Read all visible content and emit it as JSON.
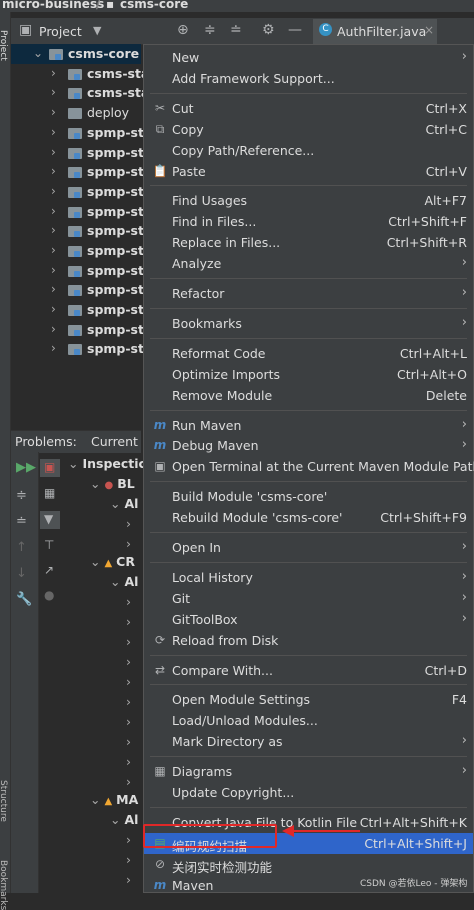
{
  "title_bar": {
    "project": "micro-business",
    "module": "csms-core"
  },
  "side_labels": {
    "project_tab": "Project",
    "structure_tab": "Structure",
    "bookmarks_tab": "Bookmarks"
  },
  "project_toolbar": {
    "view_label": "Project",
    "tab_label": "AuthFilter.java"
  },
  "tree": {
    "root": "csms-core",
    "items": [
      {
        "label": "csms-sta",
        "kind": "module"
      },
      {
        "label": "csms-sta",
        "kind": "module"
      },
      {
        "label": "deploy",
        "kind": "folder"
      },
      {
        "label": "spmp-sta",
        "kind": "module"
      },
      {
        "label": "spmp-sta",
        "kind": "module"
      },
      {
        "label": "spmp-sta",
        "kind": "module"
      },
      {
        "label": "spmp-sta",
        "kind": "module"
      },
      {
        "label": "spmp-sta",
        "kind": "module"
      },
      {
        "label": "spmp-sta",
        "kind": "module"
      },
      {
        "label": "spmp-sta",
        "kind": "module"
      },
      {
        "label": "spmp-sta",
        "kind": "module"
      },
      {
        "label": "spmp-sta",
        "kind": "module"
      },
      {
        "label": "spmp-sta",
        "kind": "module"
      },
      {
        "label": "spmp-sta",
        "kind": "module"
      },
      {
        "label": "spmp-sta",
        "kind": "module"
      }
    ]
  },
  "problems": {
    "tab_label": "Problems:",
    "current_label": "Current I",
    "root": "Inspectic",
    "groups": [
      {
        "label": "BL",
        "sub": "Al"
      },
      {
        "label": "CR",
        "sub": "Al"
      },
      {
        "label": "MA",
        "sub": "Al"
      }
    ]
  },
  "menu": [
    {
      "label": "New",
      "submenu": true
    },
    {
      "label": "Add Framework Support..."
    },
    {
      "sep": true
    },
    {
      "label": "Cut",
      "shortcut": "Ctrl+X",
      "icon": "✂"
    },
    {
      "label": "Copy",
      "shortcut": "Ctrl+C",
      "icon": "⧉"
    },
    {
      "label": "Copy Path/Reference..."
    },
    {
      "label": "Paste",
      "shortcut": "Ctrl+V",
      "icon": "📋"
    },
    {
      "sep": true
    },
    {
      "label": "Find Usages",
      "shortcut": "Alt+F7"
    },
    {
      "label": "Find in Files...",
      "shortcut": "Ctrl+Shift+F"
    },
    {
      "label": "Replace in Files...",
      "shortcut": "Ctrl+Shift+R"
    },
    {
      "label": "Analyze",
      "submenu": true
    },
    {
      "sep": true
    },
    {
      "label": "Refactor",
      "submenu": true
    },
    {
      "sep": true
    },
    {
      "label": "Bookmarks",
      "submenu": true
    },
    {
      "sep": true
    },
    {
      "label": "Reformat Code",
      "shortcut": "Ctrl+Alt+L"
    },
    {
      "label": "Optimize Imports",
      "shortcut": "Ctrl+Alt+O"
    },
    {
      "label": "Remove Module",
      "shortcut": "Delete"
    },
    {
      "sep": true
    },
    {
      "label": "Run Maven",
      "submenu": true,
      "icon": "m"
    },
    {
      "label": "Debug Maven",
      "submenu": true,
      "icon": "m"
    },
    {
      "label": "Open Terminal at the Current Maven Module Path",
      "icon": "▣"
    },
    {
      "sep": true
    },
    {
      "label": "Build Module 'csms-core'"
    },
    {
      "label": "Rebuild Module 'csms-core'",
      "shortcut": "Ctrl+Shift+F9"
    },
    {
      "sep": true
    },
    {
      "label": "Open In",
      "submenu": true
    },
    {
      "sep": true
    },
    {
      "label": "Local History",
      "submenu": true
    },
    {
      "label": "Git",
      "submenu": true
    },
    {
      "label": "GitToolBox",
      "submenu": true
    },
    {
      "label": "Reload from Disk",
      "icon": "⟳"
    },
    {
      "sep": true
    },
    {
      "label": "Compare With...",
      "shortcut": "Ctrl+D",
      "icon": "⇄"
    },
    {
      "sep": true
    },
    {
      "label": "Open Module Settings",
      "shortcut": "F4"
    },
    {
      "label": "Load/Unload Modules..."
    },
    {
      "label": "Mark Directory as",
      "submenu": true
    },
    {
      "sep": true
    },
    {
      "label": "Diagrams",
      "submenu": true,
      "icon": "▦"
    },
    {
      "label": "Update Copyright..."
    },
    {
      "sep": true
    },
    {
      "label": "Convert Java File to Kotlin File",
      "shortcut": "Ctrl+Alt+Shift+K"
    },
    {
      "label": "编码规约扫描",
      "shortcut": "Ctrl+Alt+Shift+J",
      "icon": "▤",
      "highlight": true
    },
    {
      "label": "关闭实时检测功能",
      "icon": "⊘"
    },
    {
      "label": "Maven",
      "icon": "m"
    }
  ],
  "watermark": "CSDN @若依Leo - 弹架构",
  "colors": {
    "highlight": "#2f65ca",
    "annotation": "#e02828",
    "selection": "#0d293e"
  }
}
